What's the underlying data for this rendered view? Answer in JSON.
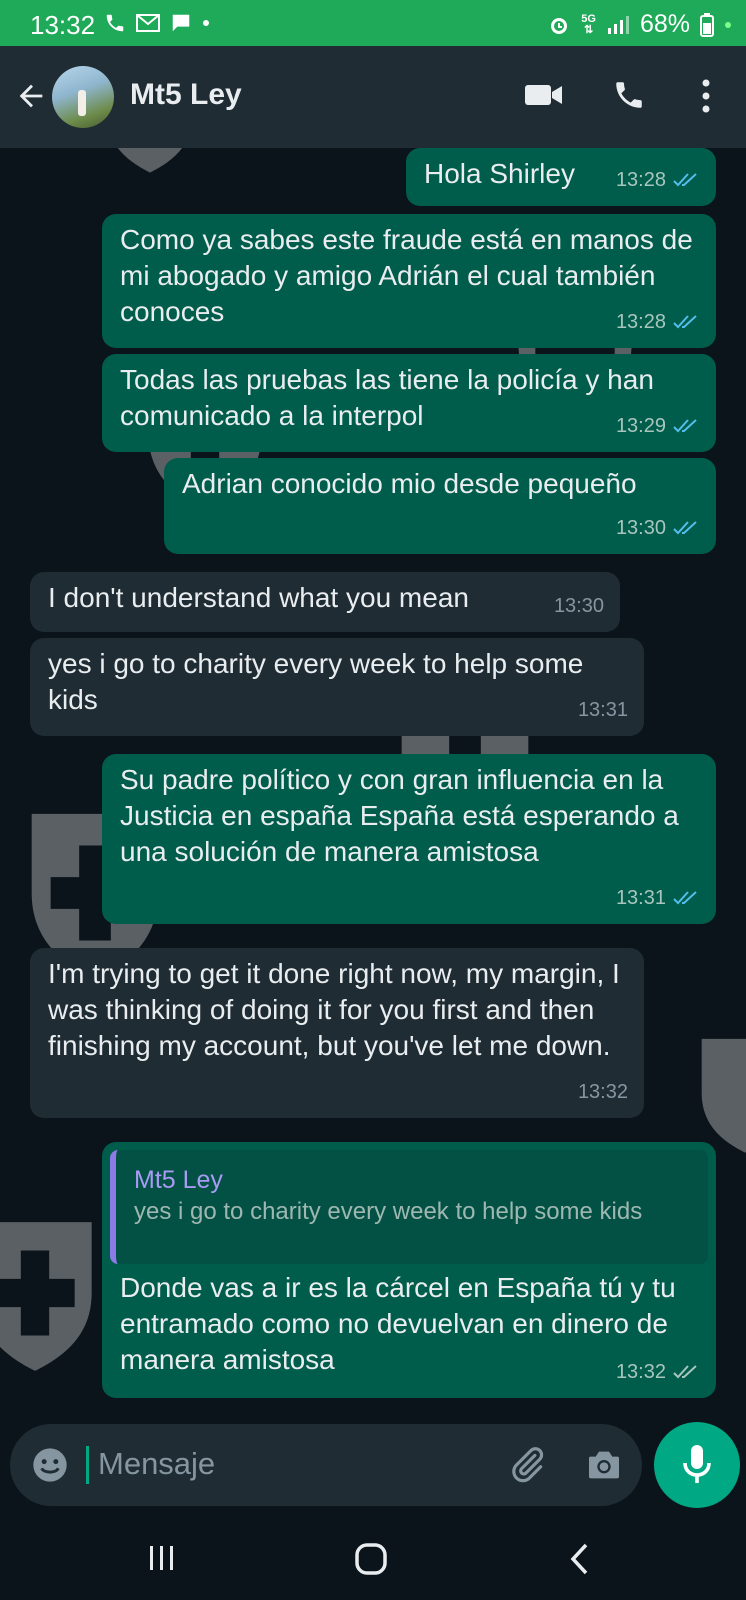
{
  "status_bar": {
    "time": "13:32",
    "network": "5G",
    "battery": "68%"
  },
  "header": {
    "contact_name": "Mt5 Ley"
  },
  "messages": [
    {
      "dir": "out",
      "text": "Hola Shirley",
      "time": "13:28",
      "ticks": "read"
    },
    {
      "dir": "out",
      "text": "Como ya sabes este fraude está en manos de mi abogado y amigo Adrián el cual también conoces",
      "time": "13:28",
      "ticks": "read"
    },
    {
      "dir": "out",
      "text": "Todas las pruebas las tiene la policía y han comunicado a la interpol",
      "time": "13:29",
      "ticks": "read"
    },
    {
      "dir": "out",
      "text": "Adrian conocido mio desde pequeño",
      "time": "13:30",
      "ticks": "read"
    },
    {
      "dir": "in",
      "text": "I don't understand what you mean",
      "time": "13:30"
    },
    {
      "dir": "in",
      "text": "yes i go to charity every week to help some kids",
      "time": "13:31"
    },
    {
      "dir": "out",
      "text": "Su padre político y con gran influencia en la Justicia en españa España está esperando a una solución de manera amistosa",
      "time": "13:31",
      "ticks": "read"
    },
    {
      "dir": "in",
      "text": "I'm trying to get it done right now, my margin, I was thinking of doing it for you first and then finishing my account, but you've let me down.",
      "time": "13:32"
    },
    {
      "dir": "out",
      "quote": {
        "name": "Mt5 Ley",
        "text": "yes i go to charity every week to help some kids"
      },
      "text": "Donde vas a ir es la cárcel en España tú y tu entramado como no devuelvan en dinero de manera amistosa",
      "time": "13:32",
      "ticks": "delivered"
    }
  ],
  "composer": {
    "placeholder": "Mensaje"
  },
  "colors": {
    "status_bar": "#1faa59",
    "header": "#1f2c33",
    "chat_bg": "#0b141a",
    "outgoing_bubble": "#005c4b",
    "incoming_bubble": "#1f2c33",
    "read_tick": "#53bdeb",
    "accent": "#00a884"
  },
  "icons": [
    "back-arrow-icon",
    "video-call-icon",
    "voice-call-icon",
    "more-options-icon",
    "emoji-icon",
    "attach-icon",
    "camera-icon",
    "microphone-icon",
    "recent-apps-icon",
    "home-icon",
    "nav-back-icon"
  ]
}
